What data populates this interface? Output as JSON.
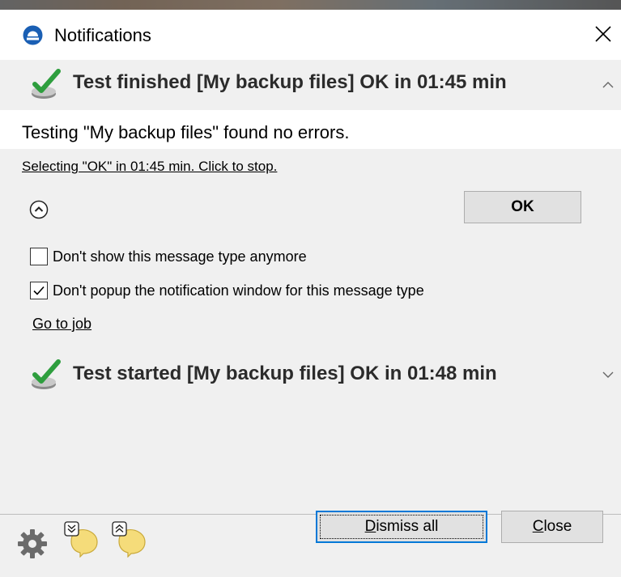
{
  "window": {
    "title": "Notifications"
  },
  "notifications": [
    {
      "title": "Test finished [My backup files] OK in 01:45 min",
      "expanded": true,
      "status_icon": "check-icon",
      "message": "Testing \"My backup files\" found no errors.",
      "countdown_text": "Selecting \"OK\" in 01:45 min. Click to stop.",
      "ok_label": "OK",
      "options": [
        {
          "label": "Don't show this message type anymore",
          "checked": false
        },
        {
          "label": "Don't popup the notification window for this message type",
          "checked": true
        }
      ],
      "goto_label": "Go to job"
    },
    {
      "title": "Test started [My backup files] OK in 01:48 min",
      "expanded": false,
      "status_icon": "check-icon"
    }
  ],
  "footer": {
    "dismiss_all_prefix": "",
    "dismiss_all_mnemonic": "D",
    "dismiss_all_rest": "ismiss all",
    "close_mnemonic": "C",
    "close_rest": "lose"
  },
  "colors": {
    "accent": "#0078d7",
    "check_green": "#2e9e3e",
    "app_blue": "#1a5fb4",
    "bubble_yellow": "#f5dc7a"
  }
}
